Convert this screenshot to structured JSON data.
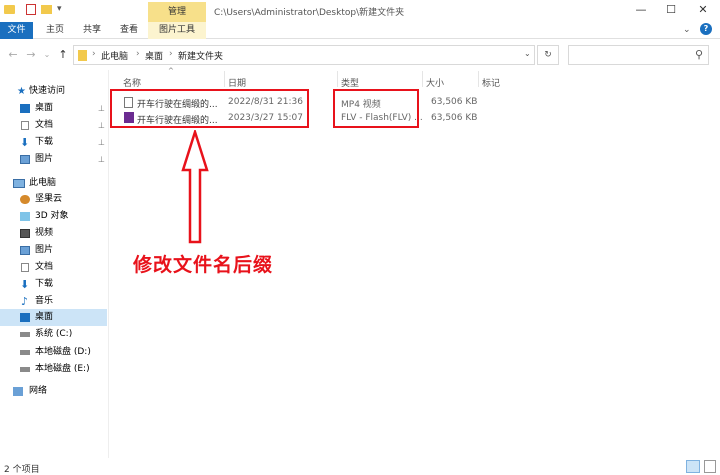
{
  "window": {
    "context_tab": "管理",
    "title_path": "C:\\Users\\Administrator\\Desktop\\新建文件夹",
    "controls": [
      "—",
      "☐",
      "✕"
    ]
  },
  "ribbon": {
    "tabs": [
      "文件",
      "主页",
      "共享",
      "查看"
    ],
    "context_tool": "图片工具",
    "help": "?"
  },
  "address": {
    "crumbs": [
      "此电脑",
      "桌面",
      "新建文件夹"
    ],
    "sep": "›",
    "refresh": "↻",
    "search_icon": "⚲"
  },
  "nav": {
    "quick_access": "快速访问",
    "quick_items": [
      {
        "label": "桌面",
        "pinned": "⊥"
      },
      {
        "label": "文档",
        "pinned": "⊥"
      },
      {
        "label": "下载",
        "pinned": "⊥"
      },
      {
        "label": "图片",
        "pinned": "⊥"
      }
    ],
    "this_pc": "此电脑",
    "pc_items": [
      "坚果云",
      "3D 对象",
      "视频",
      "图片",
      "文档",
      "下载",
      "音乐",
      "桌面",
      "系统 (C:)",
      "本地磁盘 (D:)",
      "本地磁盘 (E:)"
    ],
    "network": "网络"
  },
  "columns": [
    "名称",
    "日期",
    "类型",
    "大小",
    "标记"
  ],
  "files": [
    {
      "name": "开车行驶在绸缎的...",
      "date": "2022/8/31 21:36",
      "type": "MP4 视频",
      "size": "63,506 KB"
    },
    {
      "name": "开车行驶在绸缎的...",
      "date": "2023/3/27 15:07",
      "type": "FLV - Flash(FLV) ...",
      "size": "63,506 KB"
    }
  ],
  "annotation": "修改文件名后缀",
  "status": "2 个项目",
  "colors": {
    "accent": "#1a6fbf",
    "annotation_red": "#e8121b",
    "context_tab": "#f7e08a"
  }
}
